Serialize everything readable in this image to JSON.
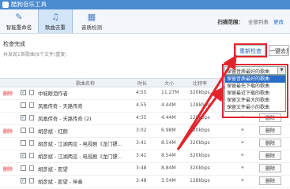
{
  "titlebar": {
    "title": "酷狗音乐工具"
  },
  "toolbar": {
    "tools": [
      {
        "label": "智能重命名",
        "icon": "rename-icon"
      },
      {
        "label": "歌曲去重",
        "icon": "music-note-icon",
        "active": true
      },
      {
        "label": "音质检测",
        "icon": "quality-icon"
      }
    ],
    "scan_label": "扫描范围：",
    "scan_value": "全部列表",
    "scan_change": "更改"
  },
  "info": {
    "status": "检查完成",
    "summary": "共发现1首歌曲(6个文件)重复："
  },
  "buttons": {
    "recheck": "重新检查",
    "onekey": "一键去重"
  },
  "dropdown": {
    "selected": "保留音质最好的歌曲",
    "options": [
      "保留音质最好的歌曲",
      "保留最先下载的歌曲",
      "保留最近下载的歌曲",
      "保留文件最大的歌曲",
      "保留文件最小的歌曲"
    ],
    "highlighted_index": 0
  },
  "table": {
    "headers": {
      "name": "歌曲名称",
      "duration": "时长",
      "size": "大小",
      "bitrate": "比特率",
      "action": "操作"
    },
    "rows": [
      {
        "del": "删除",
        "checked": true,
        "name": "中城眼泪作者",
        "duration": "4:55",
        "size": "11.27M",
        "bitrate": "320kbps",
        "action": "删除"
      },
      {
        "del": "",
        "checked": false,
        "name": "凤凰传奇 - 天路传奇",
        "duration": "4:55",
        "size": "4.44M",
        "bitrate": "128kbps",
        "action": "删除"
      },
      {
        "del": "",
        "checked": true,
        "name": "凤凰传奇 - 天路传奇 (2)",
        "duration": "4:55",
        "size": "4.44M",
        "bitrate": "128kbps",
        "action": "删除"
      },
      {
        "del": "删除",
        "checked": false,
        "name": "胡彦斌 - 红颜",
        "duration": "3:02",
        "size": "6.98M",
        "bitrate": "320kbps",
        "action": "删除"
      },
      {
        "del": "",
        "checked": false,
        "name": "胡彦斌 - 江湖两见 - 电视剧《龙门镖...",
        "duration": "3:41",
        "size": "8.54M",
        "bitrate": "320kbps",
        "action": "删除"
      },
      {
        "del": "",
        "checked": true,
        "name": "胡彦斌 - 江湖两见 - 电视剧《龙门镖...",
        "duration": "3:41",
        "size": "8.54M",
        "bitrate": "320kbps",
        "action": "删除"
      },
      {
        "del": "删除",
        "checked": false,
        "name": "胡彦斌 - 愿望",
        "duration": "3:48",
        "size": "8.84M",
        "bitrate": "320kbps",
        "action": "删除"
      },
      {
        "del": "",
        "checked": true,
        "name": "胡彦斌 - 愿望 - 伴奏",
        "duration": "3:48",
        "size": "3.54M",
        "bitrate": "128kbps",
        "action": "删除"
      }
    ]
  },
  "colors": {
    "accent": "#2a6bc7",
    "highlight": "#e0262c",
    "titlebar": "#4a8bd1"
  }
}
